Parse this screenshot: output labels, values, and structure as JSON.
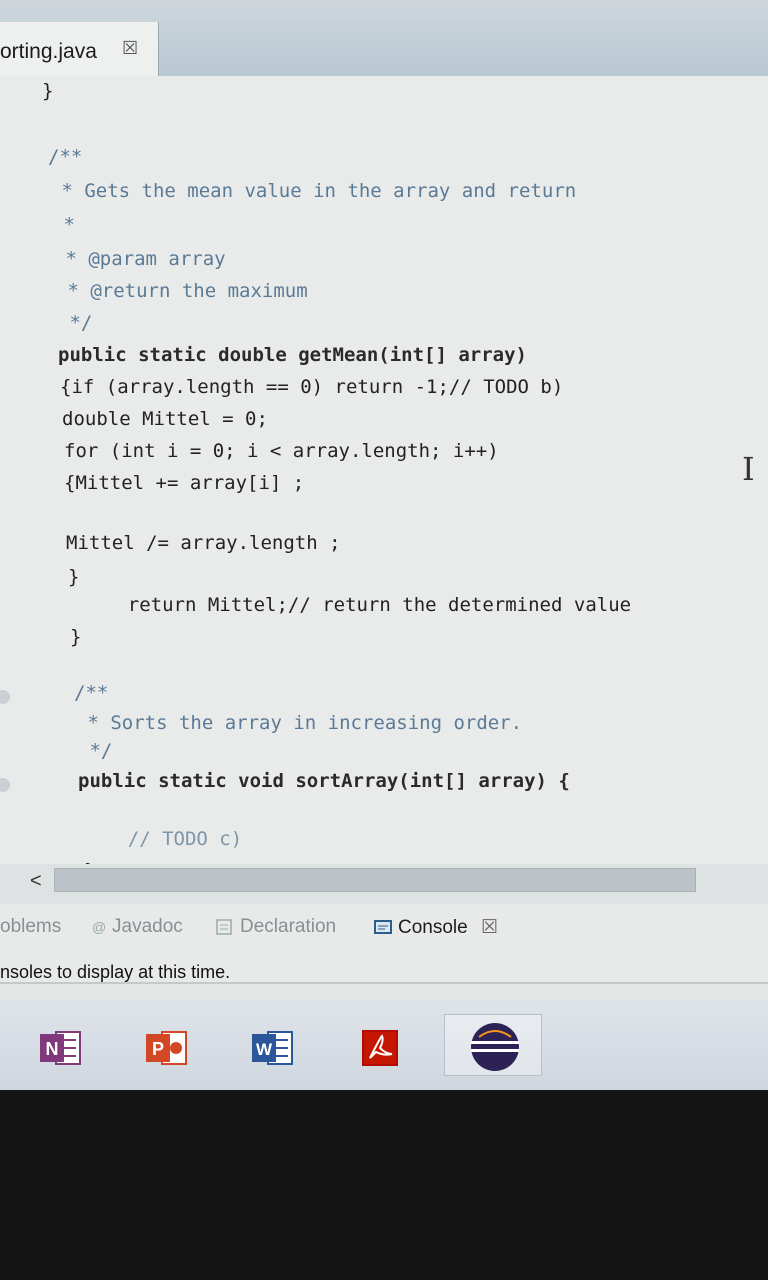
{
  "editor_tab": {
    "title": "orting.java",
    "close": "☒"
  },
  "code_lines": [
    "}",
    "/**",
    " * Gets the mean value in the array and return",
    " *",
    " * @param array",
    " * @return the maximum",
    " */",
    "public static double getMean(int[] array)",
    "{if (array.length == 0) return -1;// TODO b)",
    "double Mittel = 0;",
    "for (int i = 0; i < array.length; i++)",
    "{Mittel += array[i] ;",
    "Mittel /= array.length ;",
    "}",
    "    return Mittel;// return the determined value",
    "}",
    "/**",
    " * Sorts the array in increasing order.",
    " */",
    "public static void sortArray(int[] array) {",
    "    // TODO c)",
    "}"
  ],
  "scrollbar": {
    "left_arrow": "<"
  },
  "views": {
    "problems": "oblems",
    "javadoc": "Javadoc",
    "declaration": "Declaration",
    "console": "Console",
    "console_close": "☒",
    "console_message": "nsoles to display at this time."
  },
  "taskbar": {
    "apps": [
      {
        "name": "OneNote",
        "letter": "N",
        "color": "#80397b"
      },
      {
        "name": "PowerPoint",
        "letter": "P",
        "color": "#d24726"
      },
      {
        "name": "Word",
        "letter": "W",
        "color": "#2b579a"
      },
      {
        "name": "Adobe Reader",
        "letter": "A",
        "color": "#b30b00"
      },
      {
        "name": "Eclipse",
        "letter": "",
        "color": "#2c2255"
      }
    ]
  }
}
